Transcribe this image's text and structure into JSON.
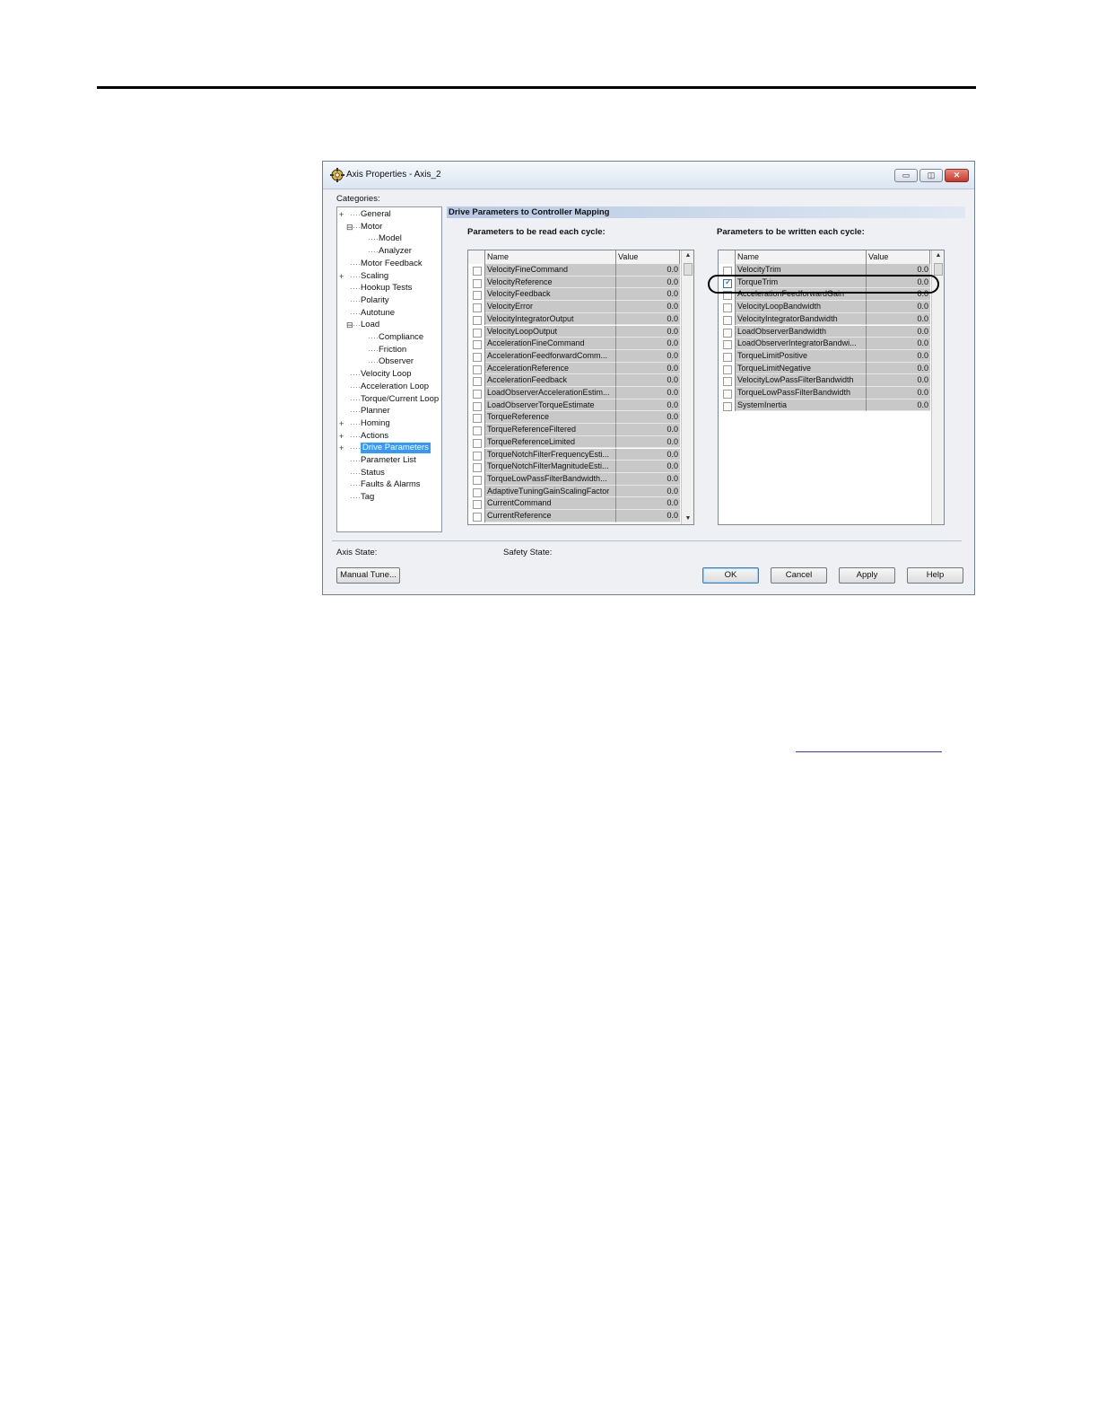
{
  "dialog": {
    "title": "Axis Properties - Axis_2",
    "window_controls": {
      "minimize": "▭",
      "maximize": "◫",
      "close": "✕"
    }
  },
  "categories": {
    "label": "Categories:",
    "items": [
      {
        "label": "General",
        "selected": false
      },
      {
        "label": "Motor",
        "selected": false
      },
      {
        "label": "Model",
        "selected": false
      },
      {
        "label": "Analyzer",
        "selected": false
      },
      {
        "label": "Motor Feedback",
        "selected": false
      },
      {
        "label": "Scaling",
        "selected": false
      },
      {
        "label": "Hookup Tests",
        "selected": false
      },
      {
        "label": "Polarity",
        "selected": false
      },
      {
        "label": "Autotune",
        "selected": false
      },
      {
        "label": "Load",
        "selected": false
      },
      {
        "label": "Compliance",
        "selected": false
      },
      {
        "label": "Friction",
        "selected": false
      },
      {
        "label": "Observer",
        "selected": false
      },
      {
        "label": "Velocity Loop",
        "selected": false
      },
      {
        "label": "Acceleration Loop",
        "selected": false
      },
      {
        "label": "Torque/Current Loop",
        "selected": false
      },
      {
        "label": "Planner",
        "selected": false
      },
      {
        "label": "Homing",
        "selected": false
      },
      {
        "label": "Actions",
        "selected": false
      },
      {
        "label": "Drive Parameters",
        "selected": true
      },
      {
        "label": "Parameter List",
        "selected": false
      },
      {
        "label": "Status",
        "selected": false
      },
      {
        "label": "Faults & Alarms",
        "selected": false
      },
      {
        "label": "Tag",
        "selected": false
      }
    ]
  },
  "section_title": "Drive Parameters to Controller Mapping",
  "read_grid": {
    "title": "Parameters to be read each cycle:",
    "columns": [
      "Name",
      "Value"
    ],
    "rows": [
      {
        "name": "VelocityFineCommand",
        "value": "0.0",
        "checked": false
      },
      {
        "name": "VelocityReference",
        "value": "0.0",
        "checked": false
      },
      {
        "name": "VelocityFeedback",
        "value": "0.0",
        "checked": false
      },
      {
        "name": "VelocityError",
        "value": "0.0",
        "checked": false
      },
      {
        "name": "VelocityIntegratorOutput",
        "value": "0.0",
        "checked": false
      },
      {
        "name": "VelocityLoopOutput",
        "value": "0.0",
        "checked": false
      },
      {
        "name": "AccelerationFineCommand",
        "value": "0.0",
        "checked": false
      },
      {
        "name": "AccelerationFeedforwardComm...",
        "value": "0.0",
        "checked": false
      },
      {
        "name": "AccelerationReference",
        "value": "0.0",
        "checked": false
      },
      {
        "name": "AccelerationFeedback",
        "value": "0.0",
        "checked": false
      },
      {
        "name": "LoadObserverAccelerationEstim...",
        "value": "0.0",
        "checked": false
      },
      {
        "name": "LoadObserverTorqueEstimate",
        "value": "0.0",
        "checked": false
      },
      {
        "name": "TorqueReference",
        "value": "0.0",
        "checked": false
      },
      {
        "name": "TorqueReferenceFiltered",
        "value": "0.0",
        "checked": false
      },
      {
        "name": "TorqueReferenceLimited",
        "value": "0.0",
        "checked": false
      },
      {
        "name": "TorqueNotchFilterFrequencyEsti...",
        "value": "0.0",
        "checked": false
      },
      {
        "name": "TorqueNotchFilterMagnitudeEsti...",
        "value": "0.0",
        "checked": false
      },
      {
        "name": "TorqueLowPassFilterBandwidth...",
        "value": "0.0",
        "checked": false
      },
      {
        "name": "AdaptiveTuningGainScalingFactor",
        "value": "0.0",
        "checked": false
      },
      {
        "name": "CurrentCommand",
        "value": "0.0",
        "checked": false
      },
      {
        "name": "CurrentReference",
        "value": "0.0",
        "checked": false
      }
    ]
  },
  "write_grid": {
    "title": "Parameters to be written each cycle:",
    "columns": [
      "Name",
      "Value"
    ],
    "rows": [
      {
        "name": "VelocityTrim",
        "value": "0.0",
        "checked": false
      },
      {
        "name": "TorqueTrim",
        "value": "0.0",
        "checked": true
      },
      {
        "name": "AccelerationFeedforwardGain",
        "value": "0.0",
        "checked": false
      },
      {
        "name": "VelocityLoopBandwidth",
        "value": "0.0",
        "checked": false
      },
      {
        "name": "VelocityIntegratorBandwidth",
        "value": "0.0",
        "checked": false
      },
      {
        "name": "LoadObserverBandwidth",
        "value": "0.0",
        "checked": false
      },
      {
        "name": "LoadObserverIntegratorBandwi...",
        "value": "0.0",
        "checked": false
      },
      {
        "name": "TorqueLimitPositive",
        "value": "0.0",
        "checked": false
      },
      {
        "name": "TorqueLimitNegative",
        "value": "0.0",
        "checked": false
      },
      {
        "name": "VelocityLowPassFilterBandwidth",
        "value": "0.0",
        "checked": false
      },
      {
        "name": "TorqueLowPassFilterBandwidth",
        "value": "0.0",
        "checked": false
      },
      {
        "name": "SystemInertia",
        "value": "0.0",
        "checked": false
      }
    ]
  },
  "status": {
    "axis_state": "Axis State:",
    "safety_state": "Safety State:"
  },
  "buttons": {
    "manual_tune": "Manual Tune...",
    "ok": "OK",
    "cancel": "Cancel",
    "apply": "Apply",
    "help": "Help"
  },
  "colors": {
    "selection": "#3399ff",
    "grid_cell": "#c8c8c8",
    "section_header": "#b7c9e3"
  },
  "icons": {
    "title": "axis-properties-icon",
    "expand": "plus-icon",
    "collapse": "minus-icon",
    "scroll_up": "scroll-up-arrow-icon",
    "scroll_down": "scroll-down-arrow-icon"
  }
}
